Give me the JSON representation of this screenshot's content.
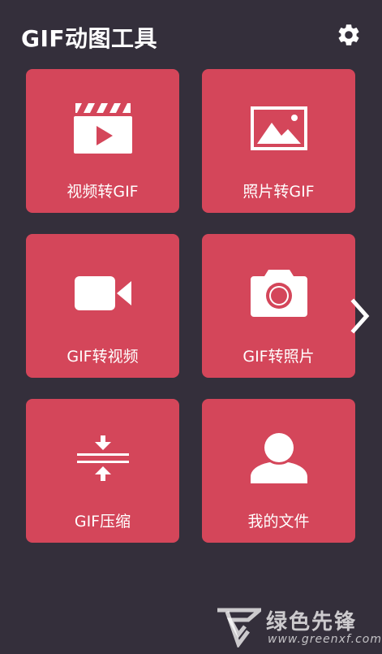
{
  "header": {
    "title": "GIF动图工具",
    "settings_icon": "gear-icon"
  },
  "tiles": [
    {
      "label": "视频转GIF",
      "icon": "film-clapper-icon"
    },
    {
      "label": "照片转GIF",
      "icon": "picture-icon"
    },
    {
      "label": "GIF转视频",
      "icon": "video-camera-icon"
    },
    {
      "label": "GIF转照片",
      "icon": "camera-icon"
    },
    {
      "label": "GIF压缩",
      "icon": "compress-icon"
    },
    {
      "label": "我的文件",
      "icon": "user-icon"
    }
  ],
  "next_icon": "chevron-right-icon",
  "watermark": {
    "title": "绿色先锋",
    "url": "www.greenxf.com"
  },
  "colors": {
    "background": "#342f3b",
    "tile": "#d4465a",
    "foreground": "#ffffff"
  }
}
